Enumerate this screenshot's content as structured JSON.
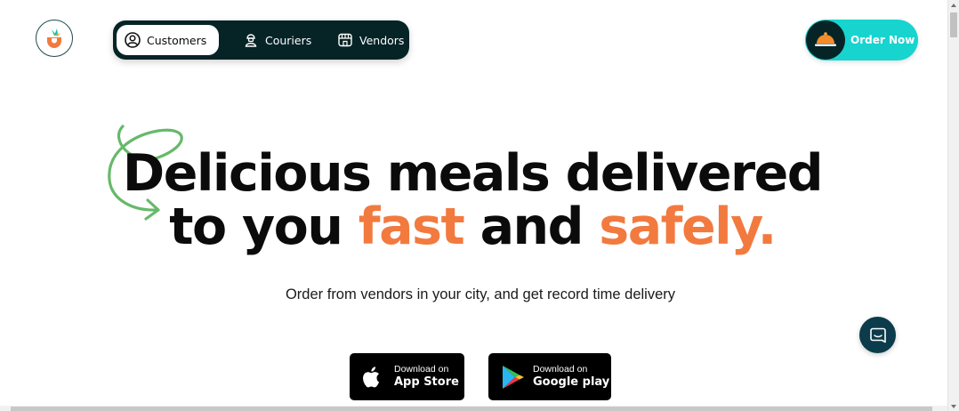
{
  "header": {
    "logo_icon": "carrot-bowl-logo-icon",
    "nav": [
      {
        "label": "Customers",
        "icon": "user-circle-icon",
        "active": true
      },
      {
        "label": "Couriers",
        "icon": "courier-icon",
        "active": false
      },
      {
        "label": "Vendors",
        "icon": "storefront-icon",
        "active": false
      }
    ],
    "order_button": {
      "label": "Order Now",
      "icon": "cloche-icon"
    }
  },
  "hero": {
    "line1": "Delicious meals delivered",
    "line2_prefix": "to you",
    "line2_accent1": "fast",
    "line2_middle": "and",
    "line2_accent2": "safely.",
    "subtitle": "Order from vendors in your city, and get record time delivery"
  },
  "downloads": {
    "app_store": {
      "small": "Download on",
      "big": "App Store",
      "icon": "apple-icon"
    },
    "google_play": {
      "small": "Download on",
      "big": "Google play",
      "icon": "google-play-icon"
    }
  },
  "chat": {
    "icon": "chat-bubble-icon"
  },
  "colors": {
    "accent_orange": "#f27a3f",
    "brand_dark": "#062326",
    "brand_teal": "#17d4cf",
    "swirl_green": "#66b96a",
    "chat_bg": "#0c3c4b"
  }
}
